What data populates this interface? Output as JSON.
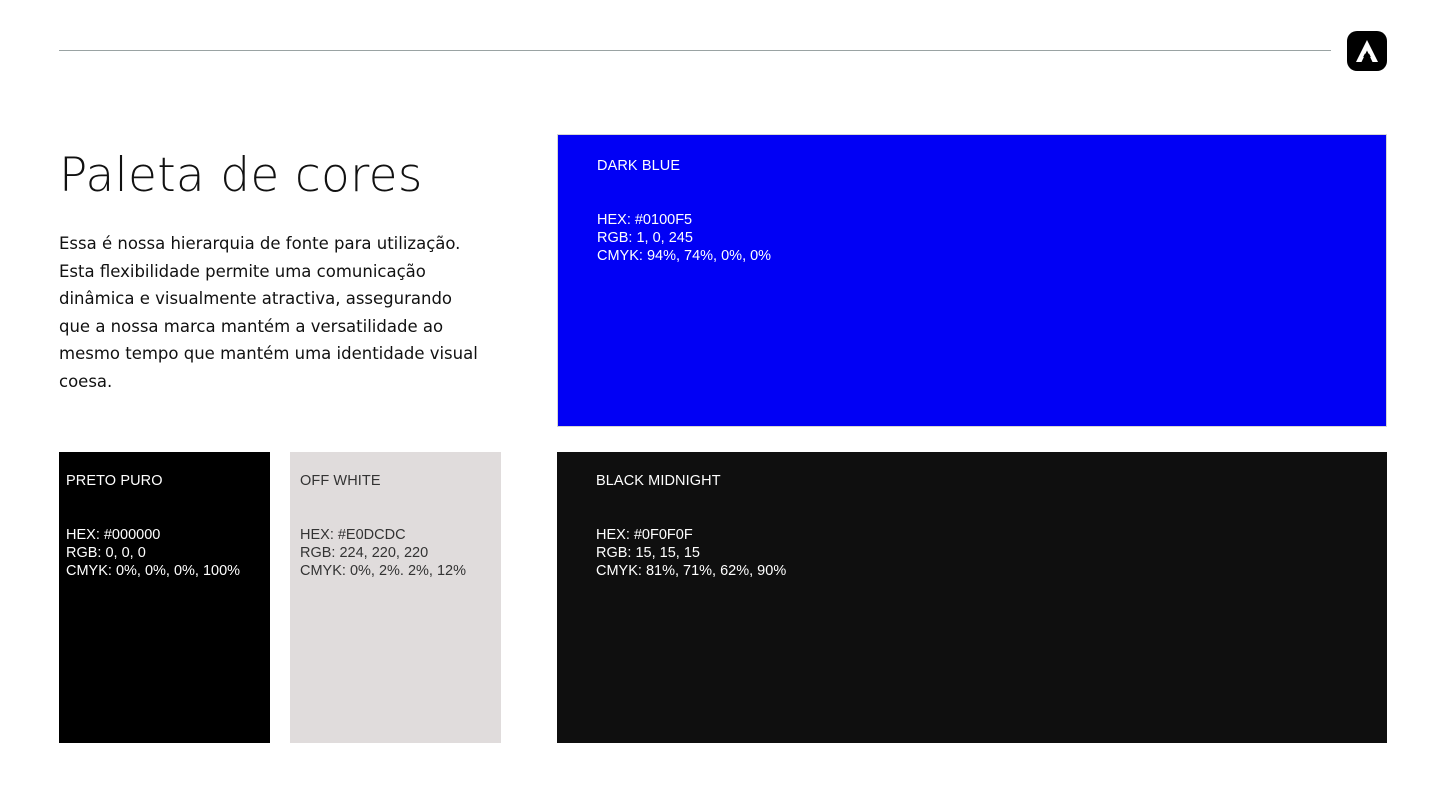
{
  "header": {
    "logo_letter": "A"
  },
  "page": {
    "title": "Paleta de cores",
    "description": "Essa é nossa hierarquia de fonte para utilização. Esta flexibilidade permite uma comunicação dinâmica e visualmente atractiva, assegurando que a nossa marca mantém a versatilidade ao mesmo tempo que mantém uma identidade visual coesa."
  },
  "swatches": {
    "dark_blue": {
      "name": "DARK BLUE",
      "hex": "HEX: #0100F5",
      "rgb": "RGB: 1, 0, 245",
      "cmyk": "CMYK: 94%, 74%, 0%, 0%",
      "color": "#0100F5"
    },
    "preto_puro": {
      "name": "PRETO PURO",
      "hex": "HEX: #000000",
      "rgb": "RGB: 0, 0, 0",
      "cmyk": "CMYK: 0%, 0%, 0%, 100%",
      "color": "#000000"
    },
    "off_white": {
      "name": "OFF WHITE",
      "hex": "HEX: #E0DCDC",
      "rgb": "RGB: 224, 220, 220",
      "cmyk": "CMYK: 0%, 2%. 2%, 12%",
      "color": "#E0DCDC"
    },
    "black_midnight": {
      "name": "BLACK MIDNIGHT",
      "hex": "HEX: #0F0F0F",
      "rgb": "RGB: 15, 15, 15",
      "cmyk": "CMYK: 81%, 71%, 62%, 90%",
      "color": "#0F0F0F"
    }
  }
}
